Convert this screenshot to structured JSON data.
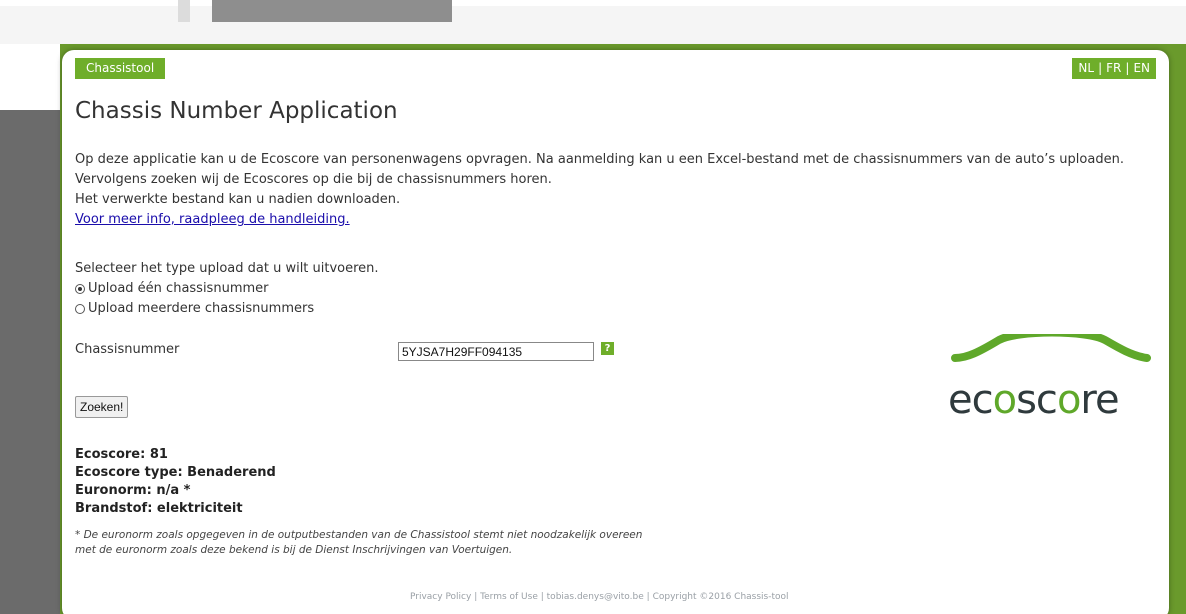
{
  "header": {
    "tab_label": "Chassistool",
    "languages": [
      "NL",
      "FR",
      "EN"
    ],
    "lang_separator": "|"
  },
  "main": {
    "title": "Chassis Number Application",
    "intro_line1": "Op deze applicatie kan u de Ecoscore van personenwagens opvragen. Na aanmelding kan u een Excel-bestand met de chassisnummers van de auto’s uploaden. Vervolgens zoeken wij de Ecoscores op die bij de chassisnummers horen.",
    "intro_line2": "Het verwerkte bestand kan u nadien downloaden.",
    "intro_link": "Voor meer info, raadpleeg de handleiding.",
    "upload_type_label": "Selecteer het type upload dat u wilt uitvoeren.",
    "upload_options": [
      "Upload één chassisnummer",
      "Upload meerdere chassisnummers"
    ],
    "selected_option": 0,
    "field_label": "Chassisnummer",
    "field_value": "5YJSA7H29FF094135",
    "help_icon_text": "?",
    "search_button": "Zoeken!"
  },
  "results": {
    "ecoscore": "Ecoscore: 81",
    "type": "Ecoscore type: Benaderend",
    "euronorm": "Euronorm: n/a *",
    "fuel": "Brandstof: elektriciteit",
    "note_line1": "* De euronorm zoals opgegeven in de outputbestanden van de Chassistool stemt niet noodzakelijk overeen",
    "note_line2": "met de euronorm zoals deze bekend is bij de Dienst Inschrijvingen van Voertuigen."
  },
  "logo": {
    "text_prefix": "ec",
    "text_o": "o",
    "text_mid": "sc",
    "text_o2": "o",
    "text_suffix": "re",
    "brand_color": "#5fa82a"
  },
  "footer": {
    "privacy": "Privacy Policy",
    "terms": "Terms of Use",
    "email": "tobias.denys@vito.be",
    "copyright": "Copyright ©2016 Chassis-tool",
    "sep": "|"
  },
  "colors": {
    "accent": "#6fae2a",
    "background_green": "#6a9a2c"
  }
}
